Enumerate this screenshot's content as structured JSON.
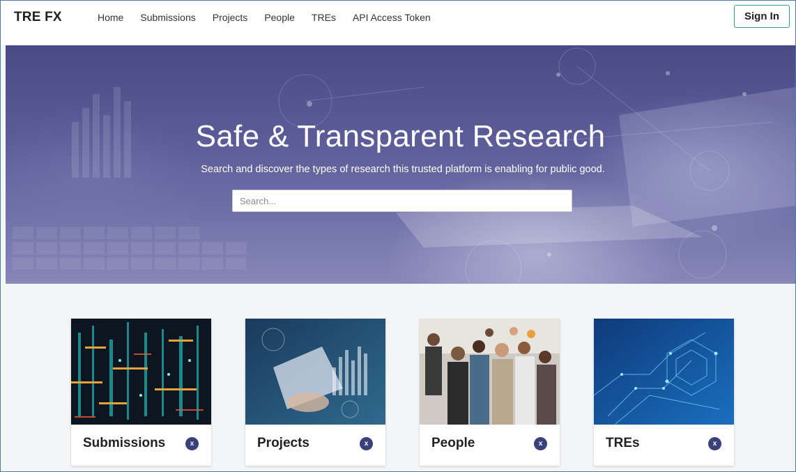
{
  "navbar": {
    "brand": "TRE FX",
    "links": [
      "Home",
      "Submissions",
      "Projects",
      "People",
      "TREs",
      "API Access Token"
    ],
    "signin_label": "Sign In"
  },
  "hero": {
    "title": "Safe & Transparent Research",
    "subtitle": "Search and discover the types of research this trusted platform is enabling for public good.",
    "search_placeholder": "Search...",
    "search_value": ""
  },
  "cards": [
    {
      "label": "Submissions",
      "badge": "x"
    },
    {
      "label": "Projects",
      "badge": "x"
    },
    {
      "label": "People",
      "badge": "x"
    },
    {
      "label": "TREs",
      "badge": "x"
    }
  ],
  "colors": {
    "hero_overlay": "#4a4a86",
    "badge": "#39407a",
    "signin_border": "#3a9a8a",
    "frame_border": "#4a7ab8"
  }
}
